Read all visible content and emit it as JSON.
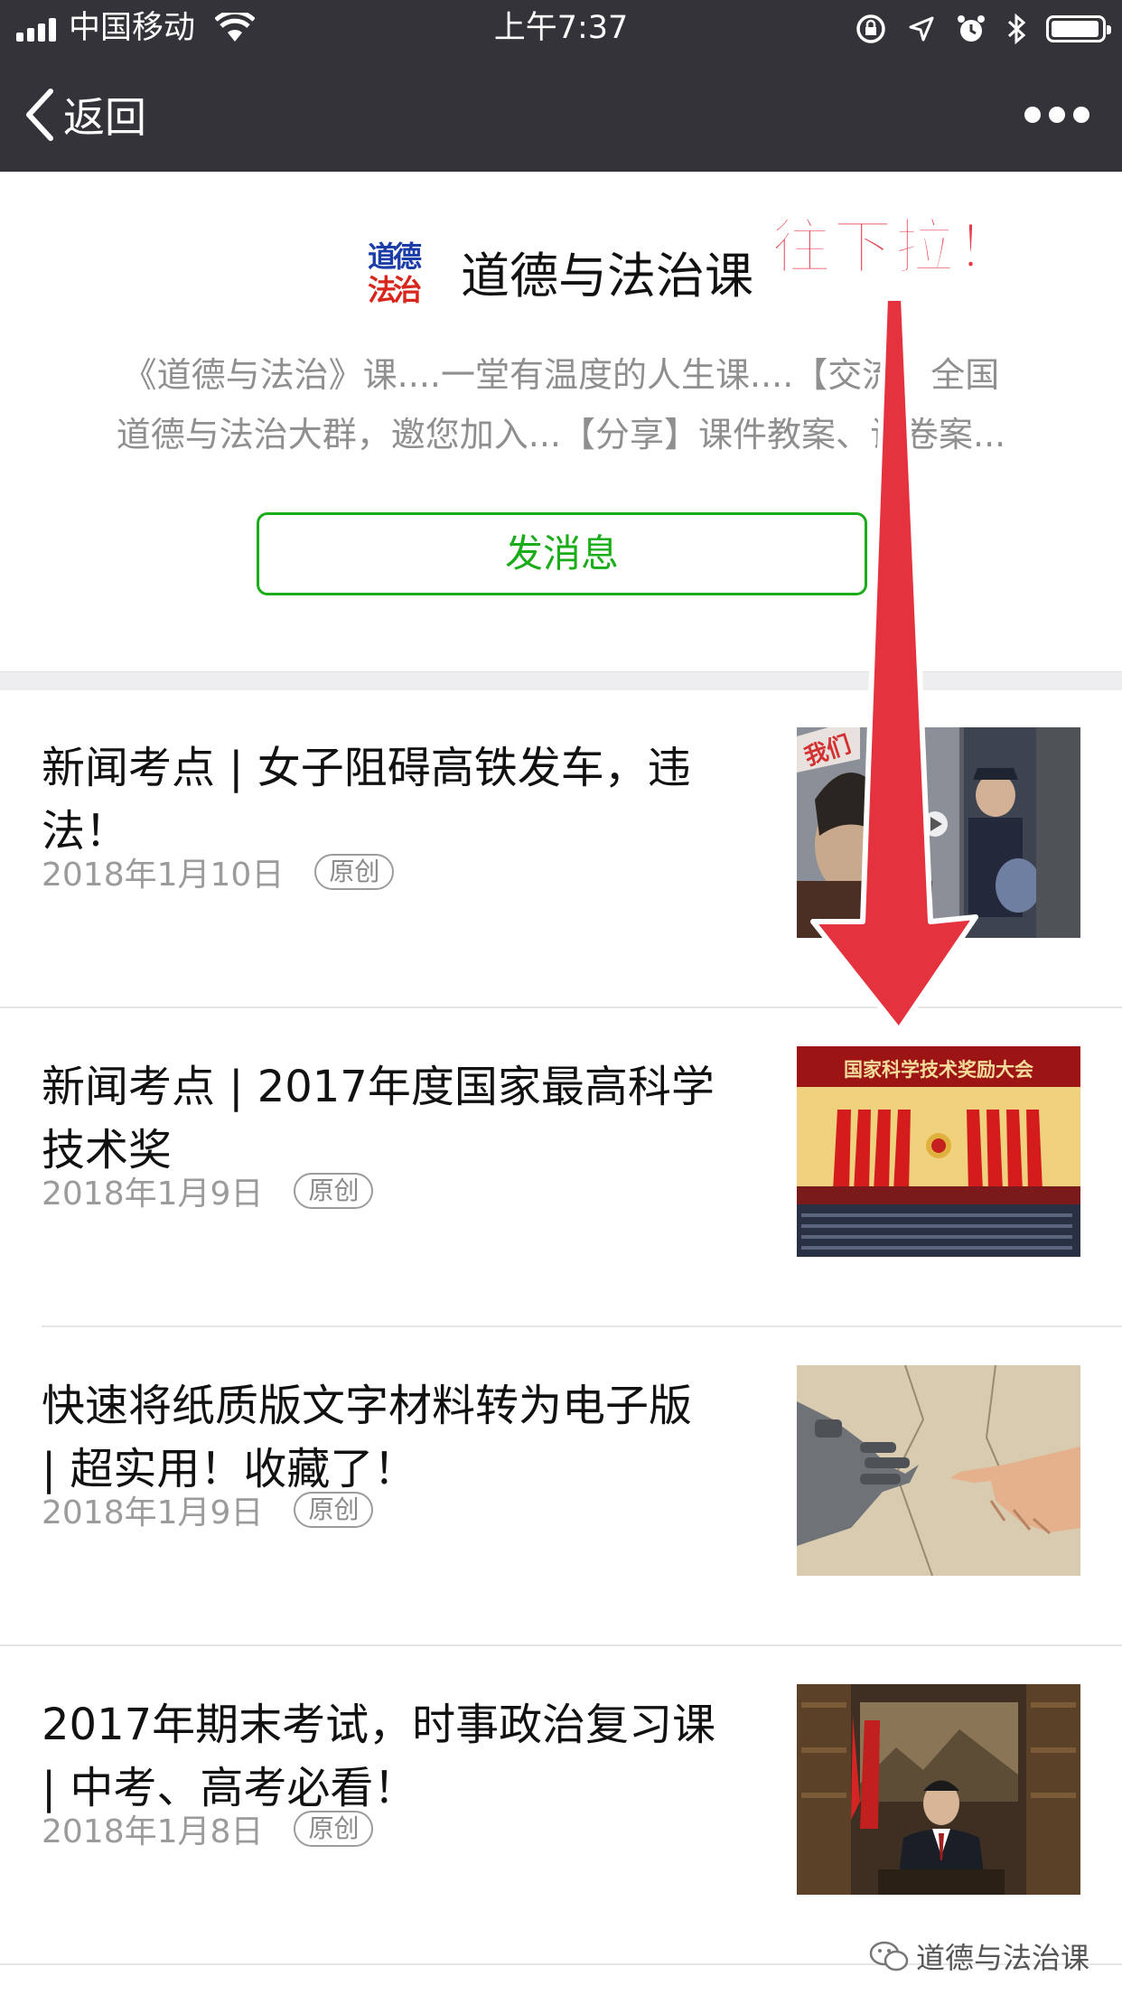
{
  "status_bar": {
    "carrier": "中国移动",
    "time": "上午7:37"
  },
  "nav": {
    "back_label": "返回"
  },
  "account": {
    "logo_text_top": "道德",
    "logo_text_bottom": "法治",
    "name": "道德与法治课",
    "description_line1": "《道德与法治》课....一堂有温度的人生课....【交流】全国",
    "description_line2": "道德与法治大群，邀您加入...【分享】课件教案、试卷案...",
    "send_message_label": "发消息"
  },
  "articles": [
    {
      "title_line1": "新闻考点 | 女子阻碍高铁发车，违",
      "title_line2": "法！",
      "date": "2018年1月10日",
      "badge": "原创",
      "thumb_text": "我们"
    },
    {
      "title_line1": "新闻考点 | 2017年度国家最高科学",
      "title_line2": "技术奖",
      "date": "2018年1月9日",
      "badge": "原创",
      "thumb_text": "国家科学技术奖励大会"
    },
    {
      "title_line1": "快速将纸质版文字材料转为电子版",
      "title_line2": "| 超实用！收藏了！",
      "date": "2018年1月9日",
      "badge": "原创"
    },
    {
      "title_line1": "2017年期末考试，时事政治复习课",
      "title_line2": "| 中考、高考必看！",
      "date": "2018年1月8日",
      "badge": "原创"
    }
  ],
  "overlay": {
    "annotation": "往下拉！",
    "watermark": "道德与法治课"
  },
  "colors": {
    "nav_bg": "#34333a",
    "accent_green": "#1aad19",
    "annotation_red": "#e83a4b"
  }
}
